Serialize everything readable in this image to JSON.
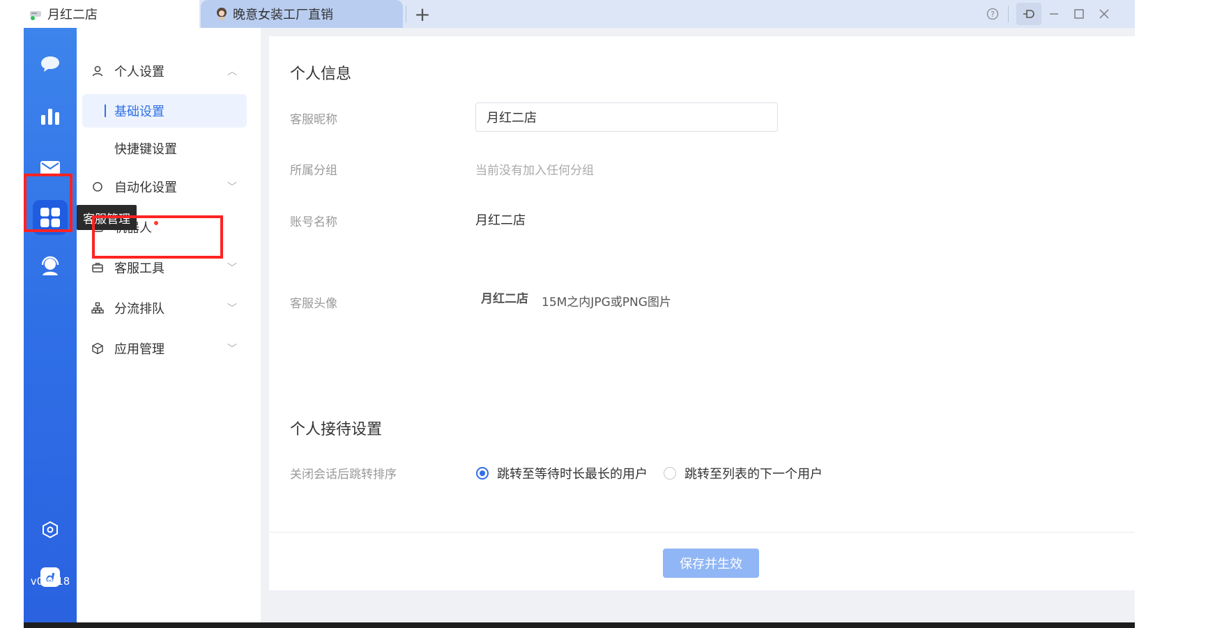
{
  "window": {
    "tabs": [
      {
        "label": "月红二店"
      },
      {
        "label": "晚意女装工厂直销"
      }
    ],
    "add_tab_symbol": "+",
    "controls": {
      "help": "?",
      "pin": "⊃",
      "minimize": "—",
      "maximize": "☐",
      "close": "✕"
    }
  },
  "rail": {
    "items": [
      {
        "icon": "chat-icon"
      },
      {
        "icon": "stats-icon"
      },
      {
        "icon": "mail-icon"
      },
      {
        "icon": "apps-grid-icon",
        "active": true
      },
      {
        "icon": "agent-icon"
      },
      {
        "icon": "settings-hex-icon"
      },
      {
        "icon": "app-logo-icon"
      }
    ],
    "version": "v0.9.18",
    "tooltip": "客服管理"
  },
  "menu": {
    "personal": {
      "label": "个人设置"
    },
    "basic": {
      "label": "基础设置"
    },
    "shortcut": {
      "label": "快捷键设置"
    },
    "automation": {
      "label": "自动化设置"
    },
    "robot": {
      "label": "机器人"
    },
    "tools": {
      "label": "客服工具"
    },
    "queue": {
      "label": "分流排队"
    },
    "apps": {
      "label": "应用管理"
    }
  },
  "content": {
    "personal_info_title": "个人信息",
    "nickname_label": "客服昵称",
    "nickname_value": "月红二店",
    "group_label": "所属分组",
    "group_value": "当前没有加入任何分组",
    "account_label": "账号名称",
    "account_value": "月红二店",
    "avatar_label": "客服头像",
    "avatar_name": "月红二店",
    "avatar_hint": "15M之内JPG或PNG图片",
    "reception_title": "个人接待设置",
    "close_sort_label": "关闭会话后跳转排序",
    "radio_option_1": "跳转至等待时长最长的用户",
    "radio_option_2": "跳转至列表的下一个用户",
    "selected_option": 1,
    "save_button": "保存并生效"
  },
  "colors": {
    "accent": "#2f6fe6",
    "highlight": "#ff2323",
    "tooltip_bg": "#2b2b2b",
    "save_button_bg": "#90b6f5"
  }
}
